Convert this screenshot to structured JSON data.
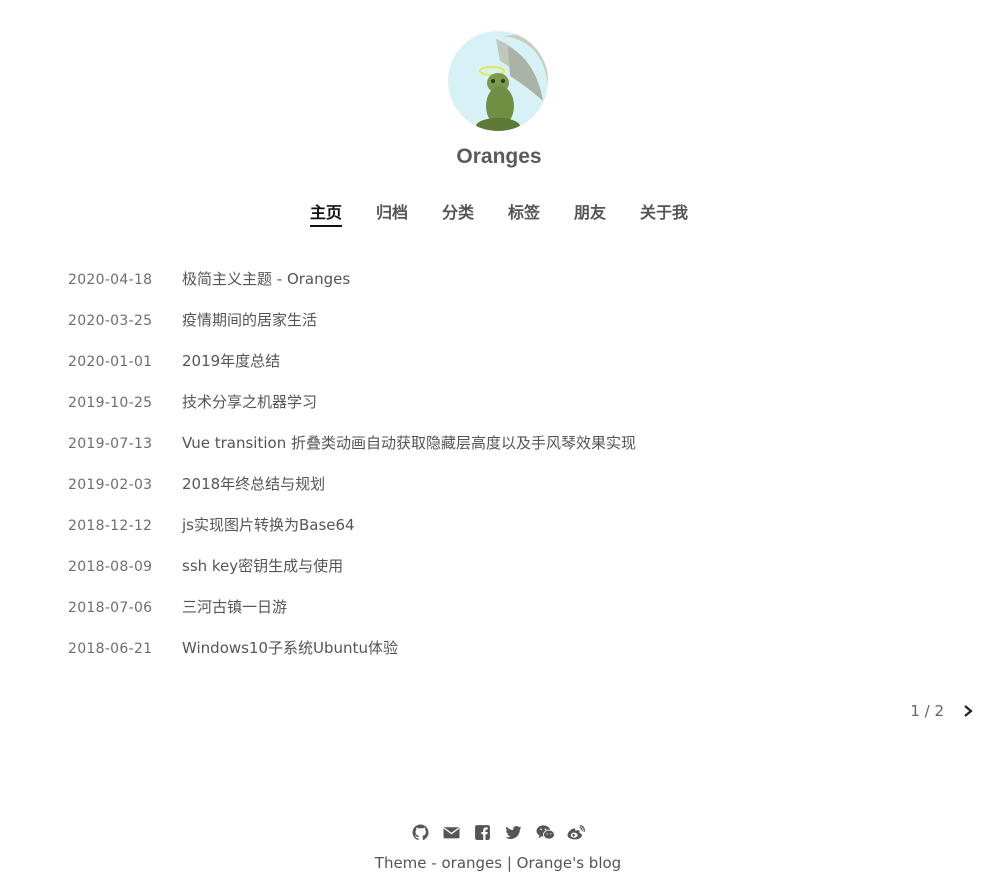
{
  "site": {
    "title": "Oranges"
  },
  "nav": [
    {
      "label": "主页",
      "active": true
    },
    {
      "label": "归档"
    },
    {
      "label": "分类"
    },
    {
      "label": "标签"
    },
    {
      "label": "朋友"
    },
    {
      "label": "关于我"
    }
  ],
  "posts": [
    {
      "date": "2020-04-18",
      "title": "极简主义主题 - Oranges"
    },
    {
      "date": "2020-03-25",
      "title": "疫情期间的居家生活"
    },
    {
      "date": "2020-01-01",
      "title": "2019年度总结"
    },
    {
      "date": "2019-10-25",
      "title": "技术分享之机器学习"
    },
    {
      "date": "2019-07-13",
      "title": "Vue transition 折叠类动画自动获取隐藏层高度以及手风琴效果实现"
    },
    {
      "date": "2019-02-03",
      "title": "2018年终总结与规划"
    },
    {
      "date": "2018-12-12",
      "title": "js实现图片转换为Base64"
    },
    {
      "date": "2018-08-09",
      "title": "ssh key密钥生成与使用"
    },
    {
      "date": "2018-07-06",
      "title": "三河古镇一日游"
    },
    {
      "date": "2018-06-21",
      "title": "Windows10子系统Ubuntu体验"
    }
  ],
  "pagination": {
    "current": "1 / 2"
  },
  "footer": {
    "icons": [
      "github-icon",
      "email-icon",
      "facebook-icon",
      "twitter-icon",
      "wechat-icon",
      "weibo-icon"
    ],
    "theme_text": "Theme - ",
    "theme_link": "oranges",
    "separator": " | ",
    "blog_link": "Orange's blog"
  }
}
